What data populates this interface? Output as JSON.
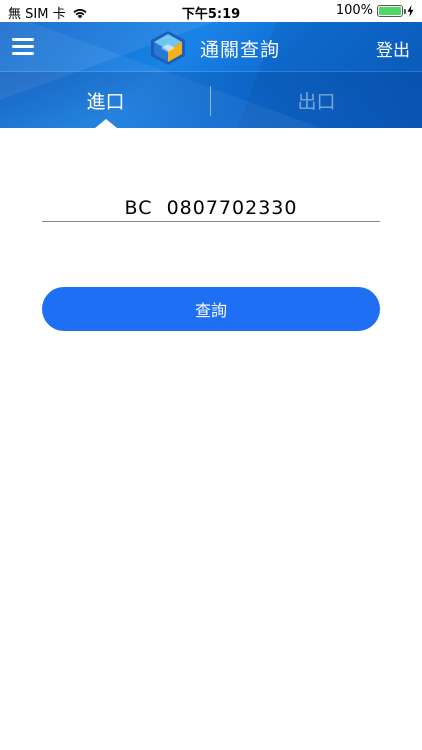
{
  "status_bar": {
    "carrier": "無 SIM 卡",
    "time": "下午5:19",
    "battery_percent": "100%"
  },
  "header": {
    "title": "通關查詢",
    "logout_label": "登出",
    "tabs": [
      {
        "label": "進口",
        "active": true
      },
      {
        "label": "出口",
        "active": false
      }
    ]
  },
  "form": {
    "query_value": "BC  0807702330",
    "submit_label": "查詢"
  },
  "colors": {
    "header_blue": "#0f6fd6",
    "button_blue": "#1f6ff5",
    "battery_green": "#4cd964"
  },
  "icons": {
    "wifi": "wifi-icon",
    "battery": "battery-icon",
    "charging": "bolt-icon",
    "menu": "hamburger-icon",
    "logo": "app-logo-icon"
  }
}
